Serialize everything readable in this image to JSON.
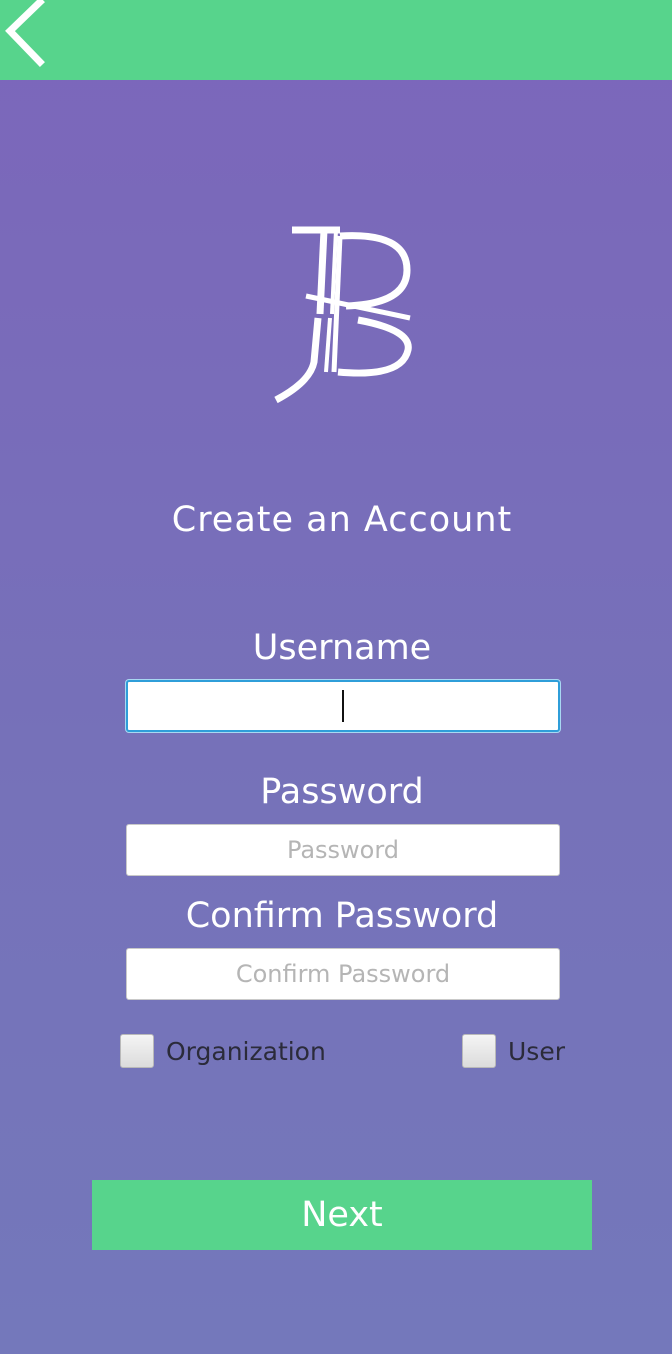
{
  "header": {
    "back_icon": "chevron-left-icon",
    "background_color": "#57d48c"
  },
  "logo": {
    "text": "JB",
    "icon": "jb-monogram-logo"
  },
  "title": "Create an Account",
  "form": {
    "username": {
      "label": "Username",
      "value": "",
      "placeholder": ""
    },
    "password": {
      "label": "Password",
      "value": "",
      "placeholder": "Password"
    },
    "confirm_password": {
      "label": "Confirm Password",
      "value": "",
      "placeholder": "Confirm Password"
    },
    "account_types": [
      {
        "label": "Organization",
        "checked": false
      },
      {
        "label": "User",
        "checked": false
      }
    ]
  },
  "next_button": {
    "label": "Next",
    "color": "#57d48c"
  },
  "colors": {
    "background_top": "#7c66bb",
    "background_bottom": "#7478bb",
    "focus_ring": "#2f9ed9"
  }
}
